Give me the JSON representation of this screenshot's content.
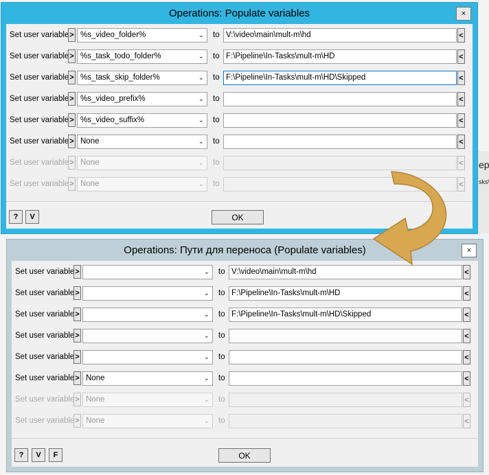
{
  "background": {
    "fragment_1": "ep",
    "fragment_2": "sks\\"
  },
  "dialog1": {
    "title": "Operations: Populate variables",
    "close": "×",
    "rows": [
      {
        "label": "Set user variable",
        "gt": ">",
        "combo": "%s_video_folder%",
        "to": "to",
        "value": "V:\\video\\main\\mult-m\\hd",
        "lt": "<"
      },
      {
        "label": "Set user variable",
        "gt": ">",
        "combo": "%s_task_todo_folder%",
        "to": "to",
        "value": "F:\\Pipeline\\In-Tasks\\mult-m\\HD",
        "lt": "<"
      },
      {
        "label": "Set user variable",
        "gt": ">",
        "combo": "%s_task_skip_folder%",
        "to": "to",
        "value": "F:\\Pipeline\\In-Tasks\\mult-m\\HD\\Skipped",
        "lt": "<"
      },
      {
        "label": "Set user variable",
        "gt": ">",
        "combo": "%s_video_prefix%",
        "to": "to",
        "value": "",
        "lt": "<"
      },
      {
        "label": "Set user variable",
        "gt": ">",
        "combo": "%s_video_suffix%",
        "to": "to",
        "value": "",
        "lt": "<"
      },
      {
        "label": "Set user variable",
        "gt": ">",
        "combo": "None",
        "to": "to",
        "value": "",
        "lt": "<"
      },
      {
        "label": "Set user variable",
        "gt": ">",
        "combo": "None",
        "to": "to",
        "value": "",
        "lt": "<"
      },
      {
        "label": "Set user variable",
        "gt": ">",
        "combo": "None",
        "to": "to",
        "value": "",
        "lt": "<"
      }
    ],
    "footer": {
      "help": "?",
      "v": "V",
      "ok": "OK"
    }
  },
  "dialog2": {
    "title": "Operations: Пути для переноса (Populate variables)",
    "close": "×",
    "rows": [
      {
        "label": "Set user variable",
        "gt": ">",
        "combo": "",
        "to": "to",
        "value": "V:\\video\\main\\mult-m\\hd",
        "lt": "<"
      },
      {
        "label": "Set user variable",
        "gt": ">",
        "combo": "",
        "to": "to",
        "value": "F:\\Pipeline\\In-Tasks\\mult-m\\HD",
        "lt": "<"
      },
      {
        "label": "Set user variable",
        "gt": ">",
        "combo": "",
        "to": "to",
        "value": "F:\\Pipeline\\In-Tasks\\mult-m\\HD\\Skipped",
        "lt": "<"
      },
      {
        "label": "Set user variable",
        "gt": ">",
        "combo": "",
        "to": "to",
        "value": "",
        "lt": "<"
      },
      {
        "label": "Set user variable",
        "gt": ">",
        "combo": "",
        "to": "to",
        "value": "",
        "lt": "<"
      },
      {
        "label": "Set user variable",
        "gt": ">",
        "combo": "None",
        "to": "to",
        "value": "",
        "lt": "<"
      },
      {
        "label": "Set user variable",
        "gt": ">",
        "combo": "None",
        "to": "to",
        "value": "",
        "lt": "<"
      },
      {
        "label": "Set user variable",
        "gt": ">",
        "combo": "None",
        "to": "to",
        "value": "",
        "lt": "<"
      }
    ],
    "footer": {
      "help": "?",
      "v": "V",
      "f": "F",
      "ok": "OK"
    }
  },
  "icons": {
    "dropdown": "chevron-down-icon",
    "arrow": "curved-arrow-icon"
  },
  "colors": {
    "dialog1_frame": "#33b5e1",
    "dialog2_frame": "#bfcfd8",
    "arrow_fill": "#d8a850"
  }
}
